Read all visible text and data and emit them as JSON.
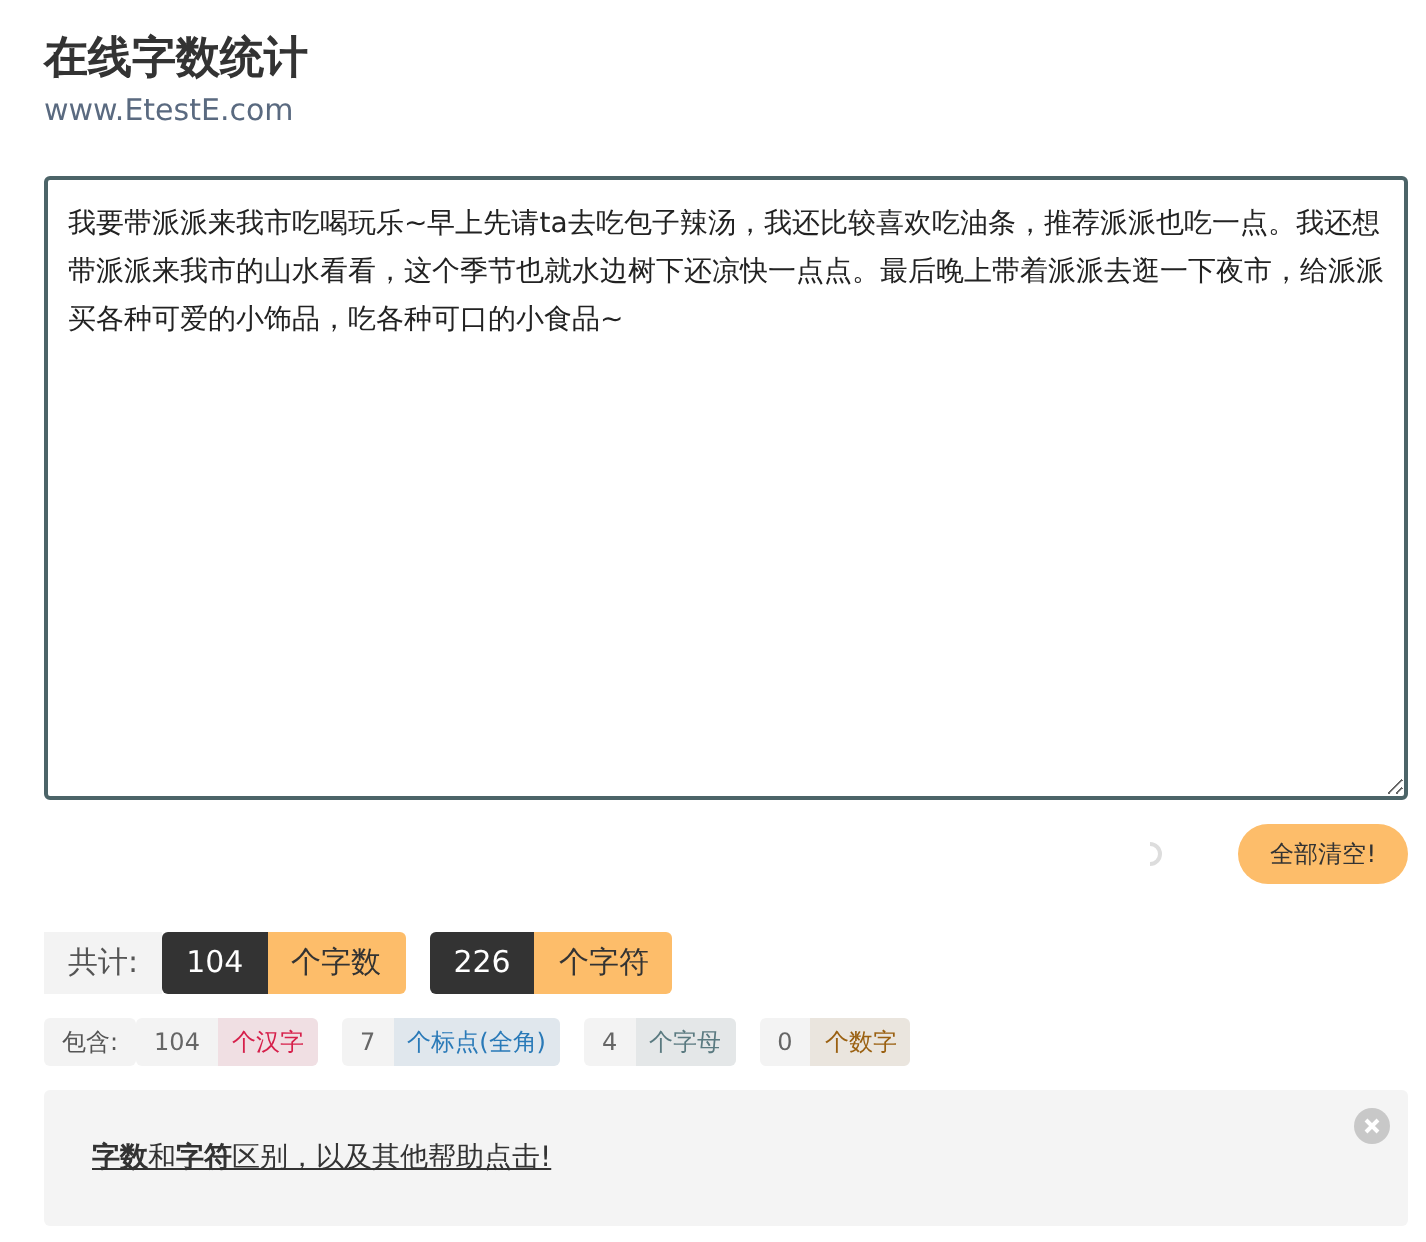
{
  "header": {
    "title": "在线字数统计",
    "site": "www.EtestE.com"
  },
  "editor": {
    "value": "我要带派派来我市吃喝玩乐~早上先请ta去吃包子辣汤，我还比较喜欢吃油条，推荐派派也吃一点。我还想带派派来我市的山水看看，这个季节也就水边树下还凉快一点点。最后晚上带着派派去逛一下夜市，给派派买各种可爱的小饰品，吃各种可口的小食品~"
  },
  "clear_button": "全部清空!",
  "totals": {
    "label": "共计:",
    "items": [
      {
        "value": "104",
        "unit": "个字数"
      },
      {
        "value": "226",
        "unit": "个字符"
      }
    ]
  },
  "breakdown": {
    "label": "包含:",
    "items": [
      {
        "value": "104",
        "unit": "个汉字",
        "color": "#d6204b"
      },
      {
        "value": "7",
        "unit": "个标点(全角)",
        "color": "#2a7ab8"
      },
      {
        "value": "4",
        "unit": "个字母",
        "color": "#5a7a80"
      },
      {
        "value": "0",
        "unit": "个数字",
        "color": "#9a6010"
      }
    ]
  },
  "help": {
    "text": "**字数**和**字符**区别，以及其他帮助点击!"
  }
}
